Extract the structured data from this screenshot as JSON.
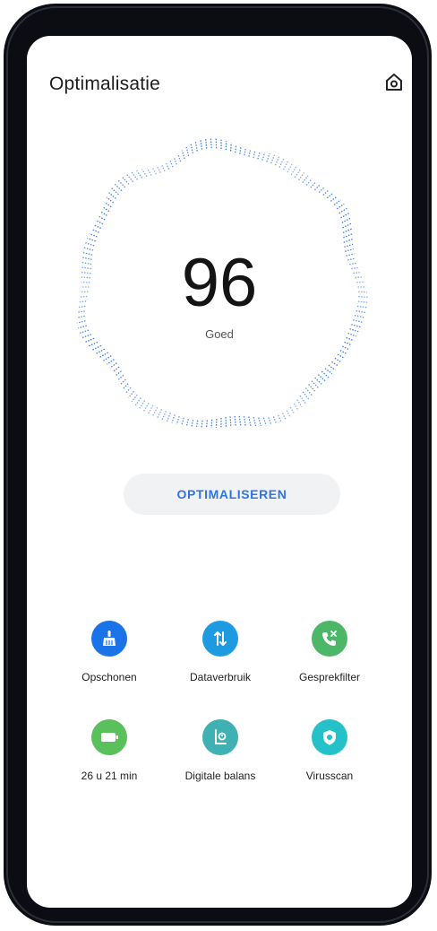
{
  "header": {
    "title": "Optimalisatie"
  },
  "score": {
    "value": "96",
    "rating": "Goed"
  },
  "actions": {
    "optimize_label": "OPTIMALISEREN"
  },
  "tools": [
    {
      "label": "Opschonen",
      "icon": "broom-icon",
      "color": "#1a73e8"
    },
    {
      "label": "Dataverbruik",
      "icon": "data-transfer-icon",
      "color": "#1e9be0"
    },
    {
      "label": "Gesprekfilter",
      "icon": "phone-filter-icon",
      "color": "#4cb867"
    },
    {
      "label": "26 u 21 min",
      "icon": "battery-icon",
      "color": "#5ac05b"
    },
    {
      "label": "Digitale balans",
      "icon": "digital-balance-icon",
      "color": "#3fb1b3"
    },
    {
      "label": "Virusscan",
      "icon": "shield-icon",
      "color": "#25c1c8"
    }
  ],
  "colors": {
    "accent": "#2f74e8",
    "gauge": "#3a7bf0"
  }
}
